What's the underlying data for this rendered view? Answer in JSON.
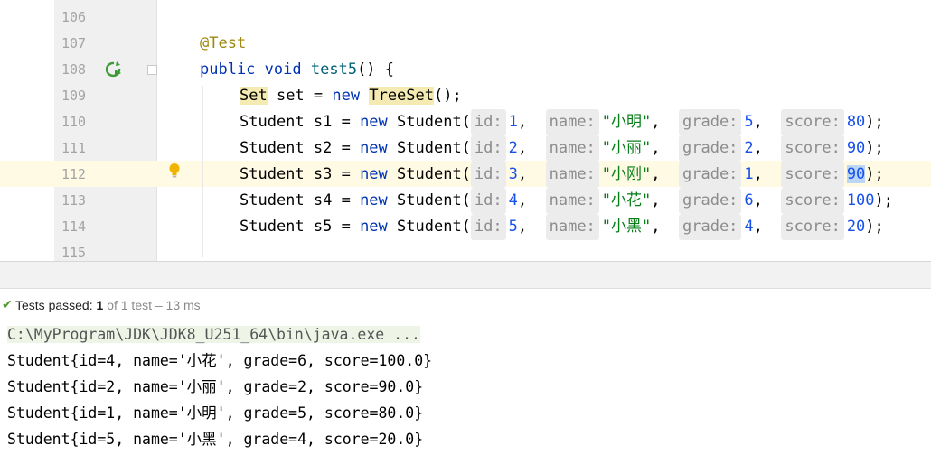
{
  "editor": {
    "line_numbers": [
      "106",
      "107",
      "108",
      "109",
      "110",
      "111",
      "112",
      "113",
      "114",
      "115"
    ],
    "annotation": "@Test",
    "kw_public": "public",
    "kw_void": "void",
    "method_name": "test5",
    "method_tail": "() {",
    "line109": {
      "type": "Set",
      "var": " set = ",
      "kw_new": "new",
      "cls": "TreeSet",
      "tail": "();"
    },
    "students": [
      {
        "decl": "Student s1 = ",
        "id": "1",
        "name": "\"小明\"",
        "grade": "5",
        "score": "80",
        "end": ");"
      },
      {
        "decl": "Student s2 = ",
        "id": "2",
        "name": "\"小丽\"",
        "grade": "2",
        "score": "90",
        "end": ");"
      },
      {
        "decl": "Student s3 = ",
        "id": "3",
        "name": "\"小刚\"",
        "grade": "1",
        "score": "90",
        "end": ");"
      },
      {
        "decl": "Student s4 = ",
        "id": "4",
        "name": "\"小花\"",
        "grade": "6",
        "score": "100",
        "end": ");"
      },
      {
        "decl": "Student s5 = ",
        "id": "5",
        "name": "\"小黑\"",
        "grade": "4",
        "score": "20",
        "end": ");"
      }
    ],
    "kw_new": "new",
    "ctor": "Student(",
    "hint_id": "id:",
    "hint_name": "name:",
    "hint_grade": "grade:",
    "hint_score": "score:"
  },
  "status": {
    "label": "Tests passed:",
    "passed": "1",
    "rest": "of 1 test – 13 ms"
  },
  "console": {
    "command": "C:\\MyProgram\\JDK\\JDK8_U251_64\\bin\\java.exe ...",
    "lines": [
      "Student{id=4, name='小花', grade=6, score=100.0}",
      "Student{id=2, name='小丽', grade=2, score=90.0}",
      "Student{id=1, name='小明', grade=5, score=80.0}",
      "Student{id=5, name='小黑', grade=4, score=20.0}"
    ]
  },
  "colors": {
    "keyword": "#0033b3",
    "number": "#1750eb",
    "string": "#067d17",
    "annotation": "#9e880d",
    "pass": "#4c9a2a"
  },
  "icons": [
    "run-test-icon",
    "fold-icon",
    "lightbulb-icon",
    "check-icon"
  ]
}
